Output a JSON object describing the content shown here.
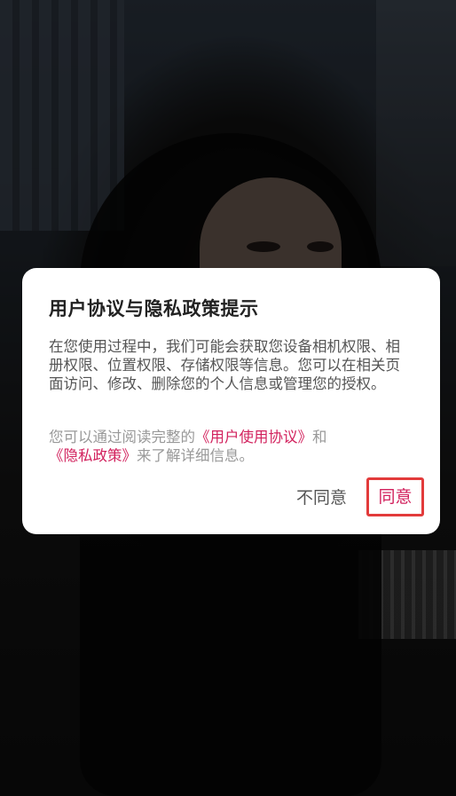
{
  "dialog": {
    "title": "用户协议与隐私政策提示",
    "body": "在您使用过程中，我们可能会获取您设备相机权限、相册权限、位置权限、存储权限等信息。您可以在相关页面访问、修改、删除您的个人信息或管理您的授权。",
    "note_prefix": "您可以通过阅读完整的",
    "user_agreement_link": "《用户使用协议》",
    "note_middle": "和",
    "privacy_policy_link": "《隐私政策》",
    "note_suffix": "来了解详细信息。",
    "disagree_label": "不同意",
    "agree_label": "同意"
  },
  "colors": {
    "accent": "#d2215d",
    "highlight_border": "#e23b3b",
    "body_text": "#555555",
    "note_text": "#999999"
  }
}
